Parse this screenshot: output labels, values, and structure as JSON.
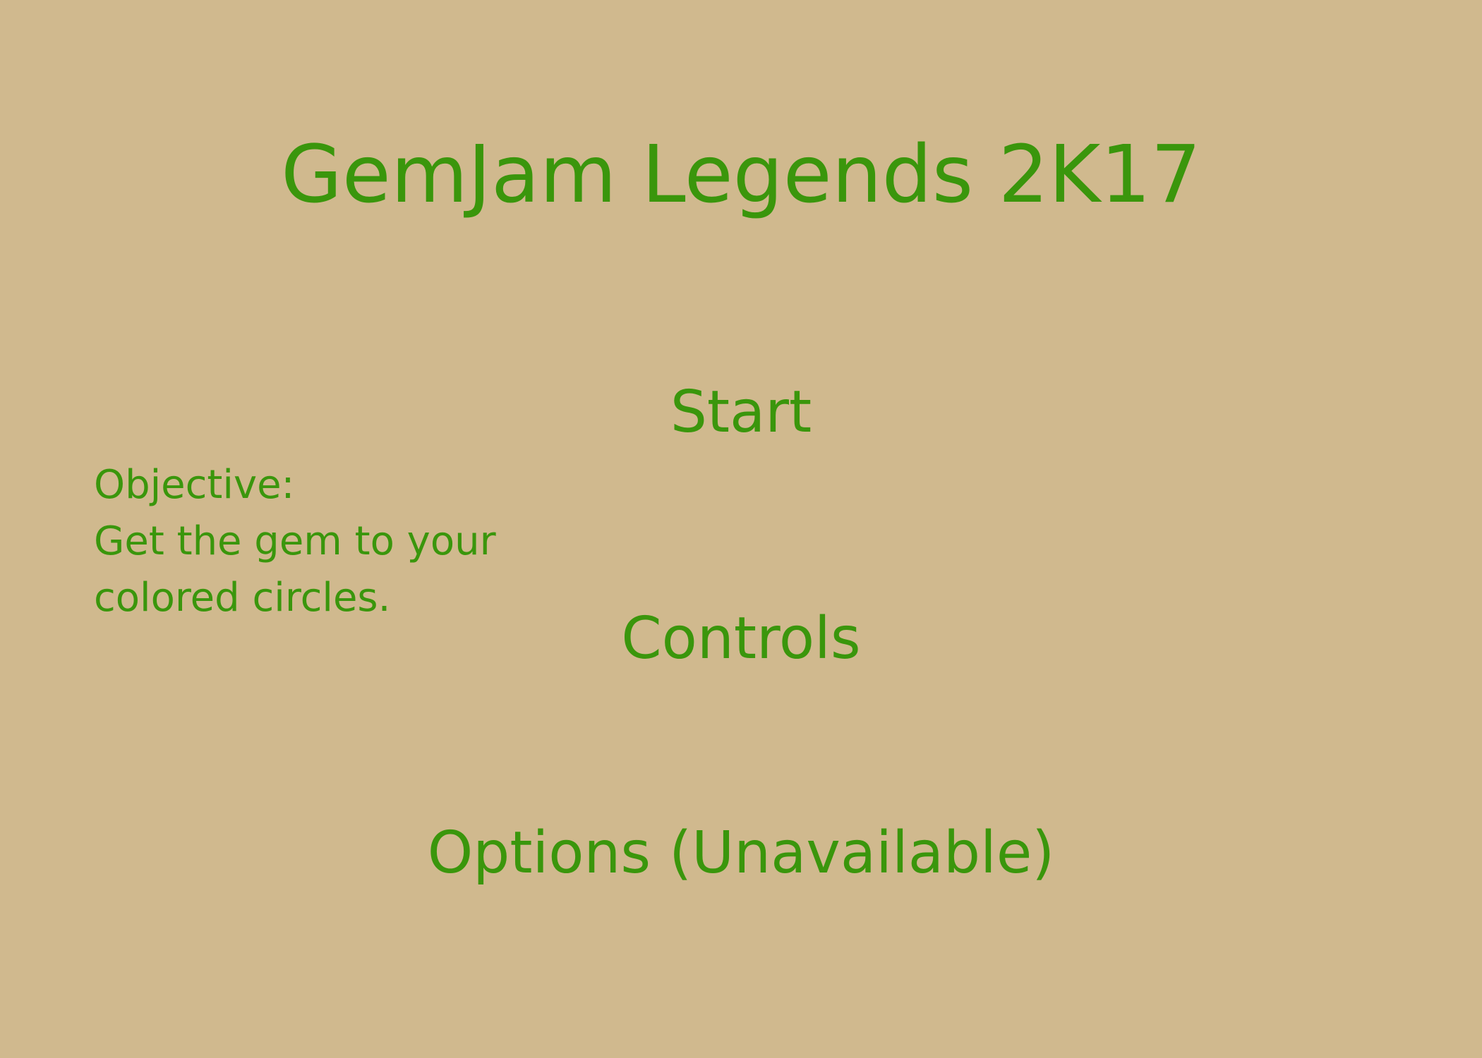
{
  "title": "GemJam Legends 2K17",
  "menu": {
    "start": "Start",
    "controls": "Controls",
    "options": "Options (Unavailable)"
  },
  "objective": {
    "heading": "Objective:",
    "lines": [
      "Get the gem to your",
      "colored circles."
    ]
  },
  "colors": {
    "background": "#d0b98e",
    "text": "#3a960c"
  }
}
